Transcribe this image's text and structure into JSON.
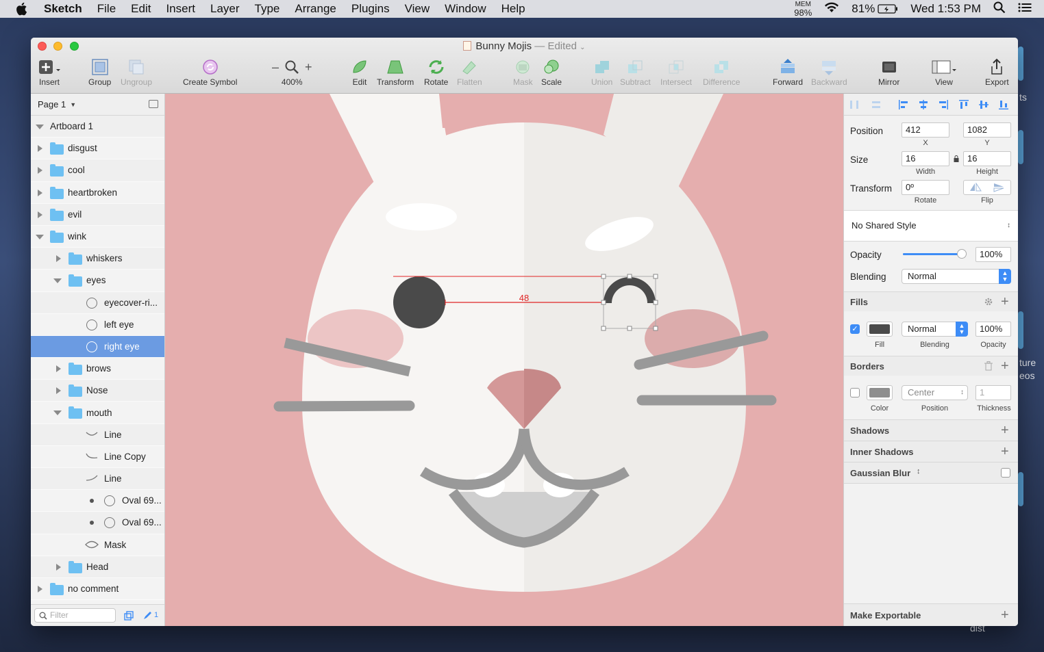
{
  "menubar": {
    "app": "Sketch",
    "items": [
      "File",
      "Edit",
      "Insert",
      "Layer",
      "Type",
      "Arrange",
      "Plugins",
      "View",
      "Window",
      "Help"
    ],
    "mem_label": "MEM",
    "mem_value": "98%",
    "battery": "81%",
    "clock": "Wed 1:53 PM"
  },
  "desktop": {
    "text1": "ts",
    "text2": "ture",
    "text3": "eos",
    "text4": "dist"
  },
  "window": {
    "title": "Bunny Mojis",
    "edited": "— Edited"
  },
  "toolbar": {
    "insert": "Insert",
    "group": "Group",
    "ungroup": "Ungroup",
    "create_symbol": "Create Symbol",
    "zoom": "400%",
    "edit": "Edit",
    "transform": "Transform",
    "rotate": "Rotate",
    "flatten": "Flatten",
    "mask": "Mask",
    "scale": "Scale",
    "union": "Union",
    "subtract": "Subtract",
    "intersect": "Intersect",
    "difference": "Difference",
    "forward": "Forward",
    "backward": "Backward",
    "mirror": "Mirror",
    "view": "View",
    "export": "Export"
  },
  "layers": {
    "page": "Page 1",
    "rows": [
      {
        "label": "Artboard 1"
      },
      {
        "label": "disgust"
      },
      {
        "label": "cool"
      },
      {
        "label": "heartbroken"
      },
      {
        "label": "evil"
      },
      {
        "label": "wink"
      },
      {
        "label": "whiskers"
      },
      {
        "label": "eyes"
      },
      {
        "label": "eyecover-ri..."
      },
      {
        "label": "left eye"
      },
      {
        "label": "right eye"
      },
      {
        "label": "brows"
      },
      {
        "label": "Nose"
      },
      {
        "label": "mouth"
      },
      {
        "label": "Line"
      },
      {
        "label": "Line Copy"
      },
      {
        "label": "Line"
      },
      {
        "label": "Oval 69..."
      },
      {
        "label": "Oval 69..."
      },
      {
        "label": "Mask"
      },
      {
        "label": "Head"
      },
      {
        "label": "no comment"
      }
    ],
    "filter_placeholder": "Filter",
    "edit_count": "1"
  },
  "canvas": {
    "distance_label": "48"
  },
  "inspector": {
    "position_label": "Position",
    "x": "412",
    "y": "1082",
    "x_label": "X",
    "y_label": "Y",
    "size_label": "Size",
    "width": "16",
    "height": "16",
    "width_label": "Width",
    "height_label": "Height",
    "transform_label": "Transform",
    "rotate": "0º",
    "rotate_label": "Rotate",
    "flip_label": "Flip",
    "shared_style": "No Shared Style",
    "opacity_label": "Opacity",
    "opacity": "100%",
    "opacity_fraction": 0.95,
    "blending_label": "Blending",
    "blending": "Normal",
    "fills_label": "Fills",
    "fill_blend": "Normal",
    "fill_opacity": "100%",
    "fill_sub": "Fill",
    "blending_sub": "Blending",
    "opacity_sub": "Opacity",
    "fill_color": "#4a4a4a",
    "borders_label": "Borders",
    "border_position": "Center",
    "border_thickness": "1",
    "color_sub": "Color",
    "position_sub": "Position",
    "thickness_sub": "Thickness",
    "border_color": "#8e8e8e",
    "shadows_label": "Shadows",
    "inner_shadows_label": "Inner Shadows",
    "gaussian_label": "Gaussian Blur",
    "export_label": "Make Exportable"
  },
  "colors": {
    "canvas_bg": "#e5aeae",
    "selection": "#6b9be2",
    "accent": "#3d8cf6",
    "measure": "#e02424"
  }
}
